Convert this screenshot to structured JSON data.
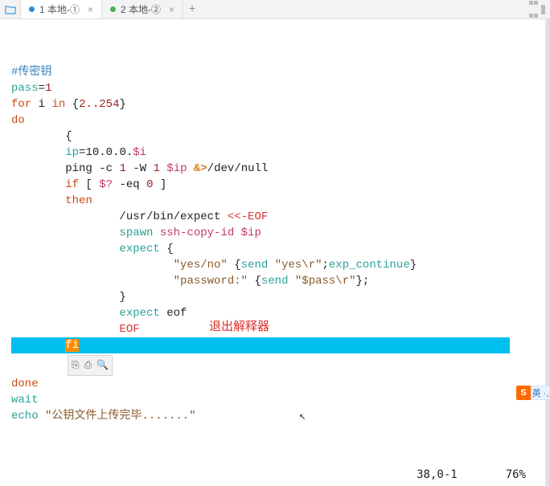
{
  "tabs": {
    "items": [
      {
        "label": "1 本地-①",
        "active": true,
        "dot": "blue"
      },
      {
        "label": "2 本地-②",
        "active": false,
        "dot": "green"
      }
    ],
    "new_tab": "+"
  },
  "code": {
    "l1_comment": "#传密钥",
    "l2_a": "pass",
    "l2_b": "=",
    "l2_c": "1",
    "l3_a": "for",
    "l3_b": " i ",
    "l3_c": "in",
    "l3_d": " {",
    "l3_e": "2..254",
    "l3_f": "}",
    "l4": "do",
    "l5_indent": "        ",
    "l5": "{",
    "l6_indent": "        ",
    "l6_a": "ip",
    "l6_b": "=",
    "l6_c": "10.0.0.",
    "l6_d": "$i",
    "l7_indent": "        ",
    "l7_a": "ping ",
    "l7_b": "-",
    "l7_c": "c ",
    "l7_d": "1",
    "l7_e": " -",
    "l7_f": "W ",
    "l7_g": "1",
    "l7_h": " $ip ",
    "l7_i": "&>",
    "l7_j": "/dev/null",
    "l8_indent": "        ",
    "l8_a": "if",
    "l8_b": " [ ",
    "l8_c": "$?",
    "l8_d": " -eq ",
    "l8_e": "0",
    "l8_f": " ]",
    "l9_indent": "        ",
    "l9": "then",
    "l10_indent": "                ",
    "l10_a": "/usr/bin/expect ",
    "l10_b": "<<-EOF",
    "l11_indent": "                ",
    "l11_a": "spawn",
    "l11_b": " ssh-copy-id $ip",
    "l12_indent": "                ",
    "l12_a": "expect",
    "l12_b": " {",
    "l13_indent": "                        ",
    "l13_a": "\"yes/no\"",
    "l13_b": " {",
    "l13_c": "send",
    "l13_d": " ",
    "l13_e": "\"yes\\r\"",
    "l13_f": ";",
    "l13_g": "exp_continue",
    "l13_h": "}",
    "l14_indent": "                        ",
    "l14_a": "\"password:\"",
    "l14_b": " {",
    "l14_c": "send",
    "l14_d": " ",
    "l14_e": "\"$pass\\r\"",
    "l14_f": "};",
    "l15_indent": "                ",
    "l15": "}",
    "l16_indent": "                ",
    "l16_a": "expect",
    "l16_b": " eof",
    "l17_indent": "                ",
    "l17": "EOF",
    "l18_indent": "        ",
    "l18_fi": "fi",
    "l19": "done",
    "l20": "wait",
    "l21_a": "echo",
    "l21_b": " ",
    "l21_c": "\"公钥文件上传完毕.......\""
  },
  "annotation": "退出解释器",
  "mini_toolbar": {
    "i1": "⎘",
    "i2": "⎙",
    "i3": "🔍"
  },
  "status": {
    "pos": "38,0-1",
    "pct": "76%"
  },
  "ime": {
    "s": "S",
    "lang": "英 ·,"
  }
}
